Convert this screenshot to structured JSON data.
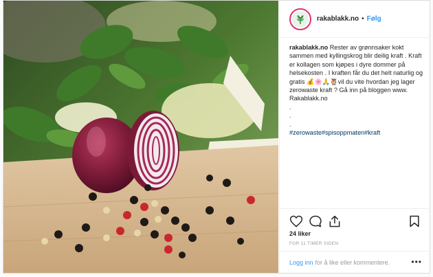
{
  "post": {
    "username": "rakablakk.no",
    "separator": "•",
    "follow_label": "Følg",
    "caption_text": "Rester av grønnsaker kokt sammen med kyllingskrog blir deilig kraft . Kraft er kollagen som kjøpes i dyre dommer på helsekosten . I kraften får du det helt naturlig og gratis 💰🌸🙏🦉vil du vite hvordan jeg lager zerowaste kraft ? Gå inn på bloggen www. Rakablakk.no",
    "caption_dots": [
      ".",
      ".",
      "."
    ],
    "hashtags": "#zerowaste#spisoppmaten#kraft",
    "likes": "24 liker",
    "time": "FOR 11 TIMER SIDEN",
    "login_label": "Logg inn",
    "login_suffix": "for å like eller kommentere.",
    "more_label": "•••"
  },
  "icons": [
    "heart-icon",
    "comment-icon",
    "share-icon",
    "bookmark-icon",
    "leaf-logo-icon"
  ],
  "colors": {
    "link": "#3897f0",
    "hashtag": "#003569",
    "text": "#262626",
    "muted": "#999999"
  }
}
